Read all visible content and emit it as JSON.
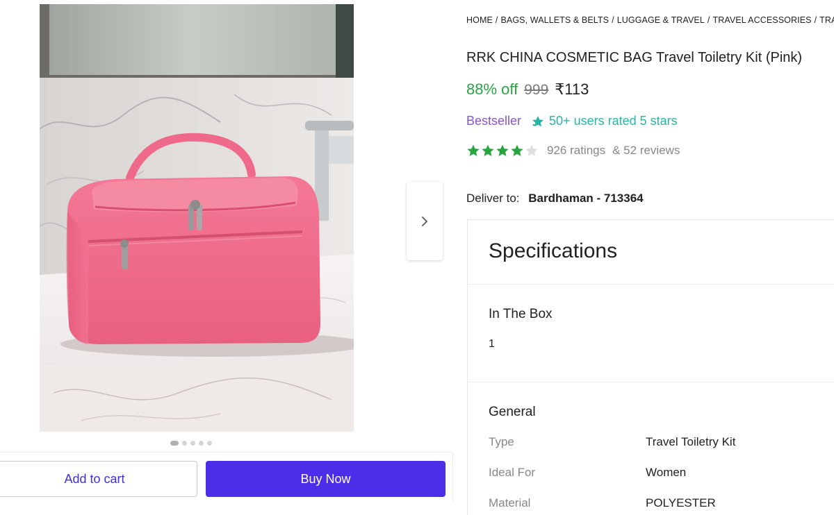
{
  "breadcrumb": [
    "HOME",
    "BAGS, WALLETS & BELTS",
    "LUGGAGE & TRAVEL",
    "TRAVEL ACCESSORIES",
    "TRAV"
  ],
  "product": {
    "title": "RRK CHINA COSMETIC BAG Travel Toiletry Kit (Pink)",
    "discount": "88% off",
    "mrp": "999",
    "price": "₹113",
    "badge": "Bestseller",
    "rated_badge": "50+ users rated 5 stars",
    "rating_value": 4,
    "ratings_count": "926 ratings",
    "reviews_count": "& 52 reviews"
  },
  "delivery": {
    "label": "Deliver to:",
    "location": "Bardhaman - 713364"
  },
  "carousel": {
    "dots": 5,
    "active_index": 0
  },
  "actions": {
    "add_to_cart": "Add to cart",
    "buy_now": "Buy Now"
  },
  "specifications": {
    "title": "Specifications",
    "in_the_box": {
      "heading": "In The Box",
      "value": "1"
    },
    "general": {
      "heading": "General",
      "rows": [
        {
          "key": "Type",
          "value": "Travel Toiletry Kit"
        },
        {
          "key": "Ideal For",
          "value": "Women"
        },
        {
          "key": "Material",
          "value": "POLYESTER"
        }
      ]
    }
  },
  "icons": {
    "next": "chevron-right-icon",
    "star": "star-icon",
    "badge": "sparkle-star-icon"
  },
  "colors": {
    "discount": "#26a541",
    "buy_now": "#4d2ee8",
    "bestseller": "#8a55c9",
    "rated_badge": "#2bb3a3",
    "star_filled": "#26a541"
  }
}
